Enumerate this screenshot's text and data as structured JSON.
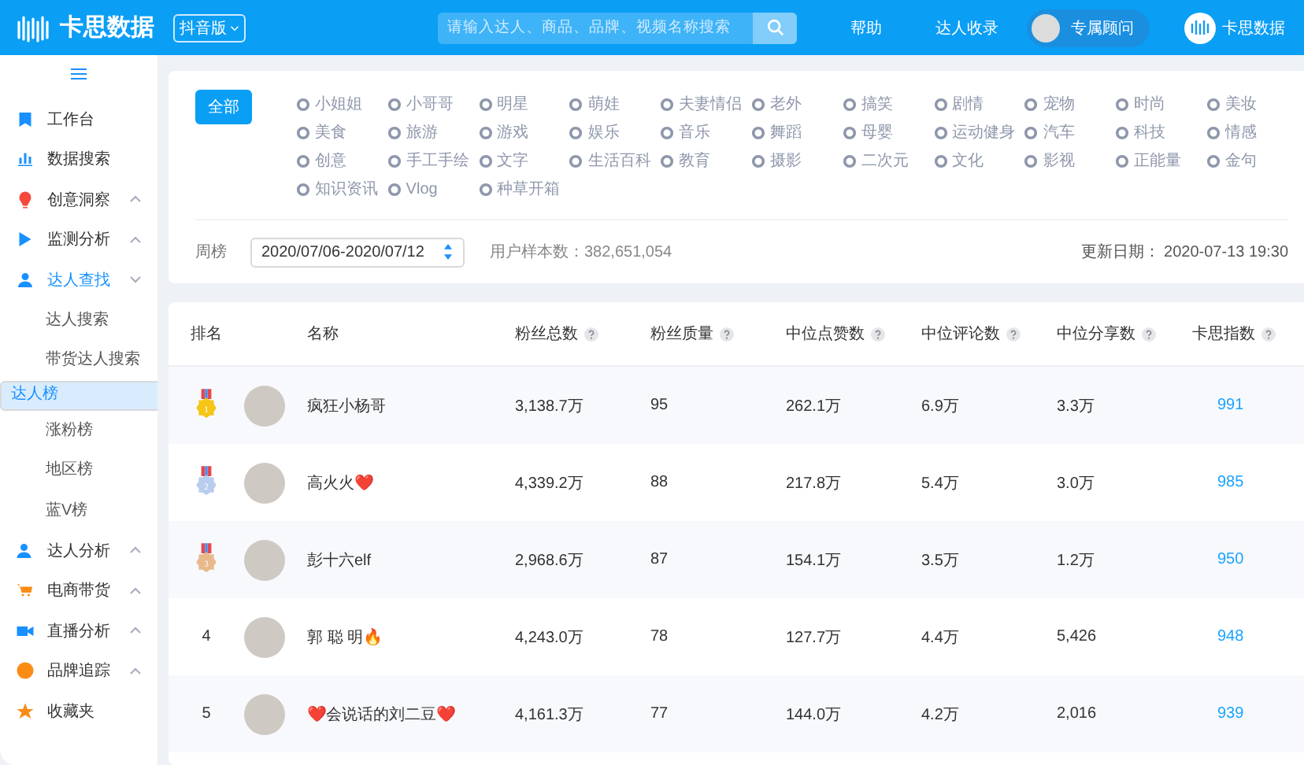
{
  "header": {
    "brand": "卡思数据",
    "edition": "抖音版",
    "search": {
      "placeholder": "请输入达人、商品、品牌、视频名称搜索"
    },
    "links": [
      "帮助",
      "达人收录"
    ],
    "advisor": "专属顾问",
    "account": "卡思数据"
  },
  "sidebar": {
    "items": [
      {
        "label": "工作台",
        "color": "#1890ff"
      },
      {
        "label": "数据搜索",
        "color": "#1890ff"
      },
      {
        "label": "创意洞察",
        "color": "#f5483b",
        "expanded": false
      },
      {
        "label": "监测分析",
        "color": "#1890ff",
        "expanded": false
      },
      {
        "label": "达人查找",
        "color": "#1890ff",
        "expanded": true,
        "children": [
          {
            "label": "达人搜索",
            "selected": false
          },
          {
            "label": "带货达人搜索",
            "selected": false
          },
          {
            "label": "达人榜",
            "selected": true
          },
          {
            "label": "涨粉榜",
            "selected": false
          },
          {
            "label": "地区榜",
            "selected": false
          },
          {
            "label": "蓝V榜",
            "selected": false
          }
        ]
      },
      {
        "label": "达人分析",
        "color": "#1890ff",
        "expanded": false
      },
      {
        "label": "电商带货",
        "color": "#fa8c16",
        "expanded": false
      },
      {
        "label": "直播分析",
        "color": "#1890ff",
        "expanded": false
      },
      {
        "label": "品牌追踪",
        "color": "#fa8c16",
        "expanded": false
      },
      {
        "label": "收藏夹",
        "color": "#fa8c16"
      }
    ]
  },
  "filters": {
    "all": {
      "label": "全部",
      "selected": true
    },
    "categories": [
      [
        "小姐姐",
        "小哥哥",
        "明星",
        "萌娃",
        "夫妻情侣",
        "老外",
        "搞笑",
        "剧情",
        "宠物",
        "时尚",
        "美妆"
      ],
      [
        "美食",
        "旅游",
        "游戏",
        "娱乐",
        "音乐",
        "舞蹈",
        "母婴",
        "运动健身",
        "汽车",
        "科技",
        "情感"
      ],
      [
        "创意",
        "手工手绘",
        "文字",
        "生活百科",
        "教育",
        "摄影",
        "二次元",
        "文化",
        "影视",
        "正能量",
        "金句"
      ],
      [
        "知识资讯",
        "Vlog",
        "种草开箱"
      ]
    ],
    "period_label": "周榜",
    "period": "2020/07/06-2020/07/12",
    "sample": "用户样本数：382,651,054",
    "updated": "更新日期： 2020-07-13 19:30"
  },
  "table": {
    "columns": [
      {
        "label": "排名",
        "help": false
      },
      {
        "label": "名称",
        "help": false
      },
      {
        "label": "粉丝总数",
        "help": true
      },
      {
        "label": "粉丝质量",
        "help": true
      },
      {
        "label": "中位点赞数",
        "help": true
      },
      {
        "label": "中位评论数",
        "help": true
      },
      {
        "label": "中位分享数",
        "help": true
      },
      {
        "label": "卡思指数",
        "help": true
      }
    ],
    "rows": [
      {
        "rank": "1",
        "kind": "medal",
        "color": "#f5c518",
        "name": "疯狂小杨哥",
        "fans": "3,138.7万",
        "quality": "95",
        "likes": "262.1万",
        "comments": "6.9万",
        "shares": "3.3万",
        "score": "991"
      },
      {
        "rank": "2",
        "kind": "medal",
        "color": "#b8cdee",
        "name": "高火火❤️",
        "fans": "4,339.2万",
        "quality": "88",
        "likes": "217.8万",
        "comments": "5.4万",
        "shares": "3.0万",
        "score": "985"
      },
      {
        "rank": "3",
        "kind": "medal",
        "color": "#e8b98a",
        "name": "彭十六elf",
        "fans": "2,968.6万",
        "quality": "87",
        "likes": "154.1万",
        "comments": "3.5万",
        "shares": "1.2万",
        "score": "950"
      },
      {
        "rank": "4",
        "kind": "plain",
        "name": "郭 聪 明🔥",
        "fans": "4,243.0万",
        "quality": "78",
        "likes": "127.7万",
        "comments": "4.4万",
        "shares": "5,426",
        "score": "948"
      },
      {
        "rank": "5",
        "kind": "plain",
        "name": "❤️会说话的刘二豆❤️",
        "fans": "4,161.3万",
        "quality": "77",
        "likes": "144.0万",
        "comments": "4.2万",
        "shares": "2,016",
        "score": "939"
      }
    ]
  }
}
